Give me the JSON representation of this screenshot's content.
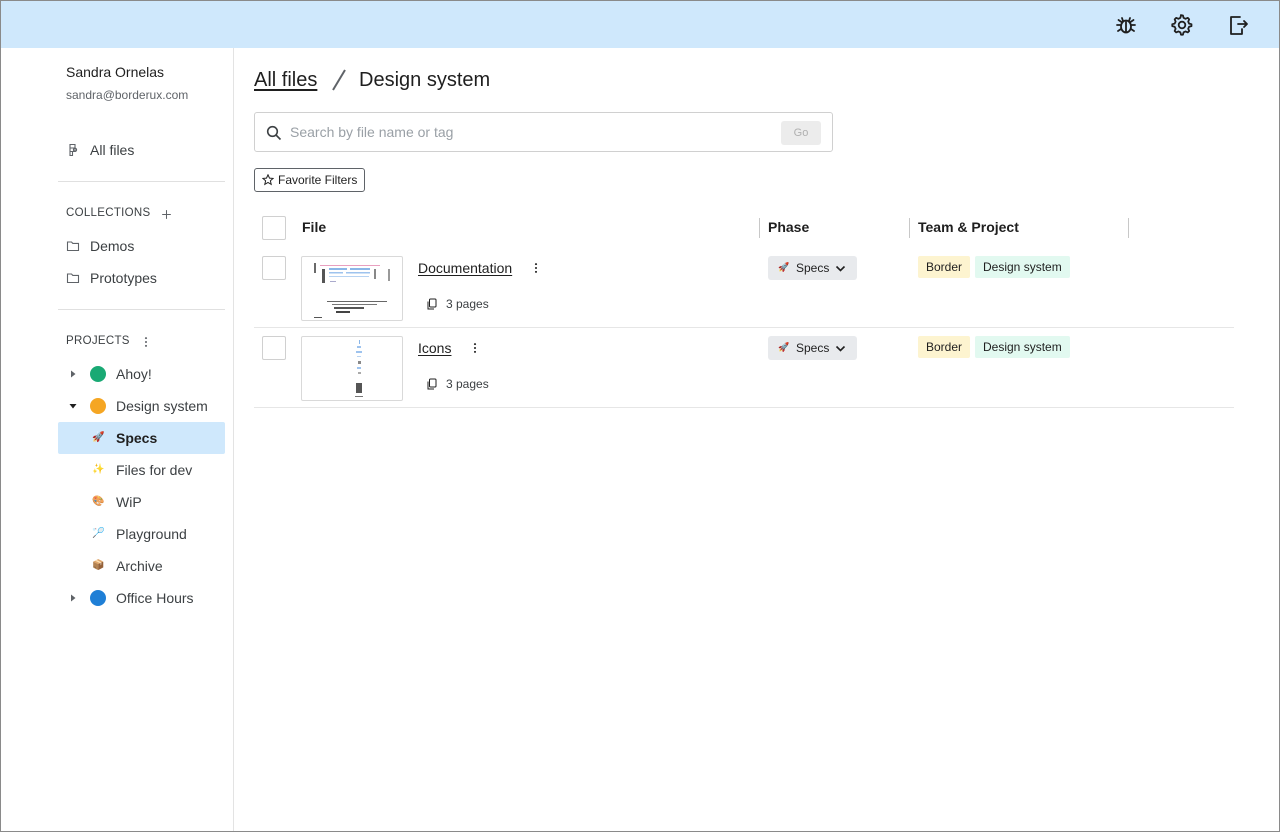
{
  "topbar": {
    "icons": [
      "bug-icon",
      "settings-gear-icon",
      "logout-icon"
    ]
  },
  "user": {
    "name": "Sandra Ornelas",
    "email": "sandra@borderux.com"
  },
  "sidebar": {
    "all_files": "All files",
    "collections_title": "COLLECTIONS",
    "collections": [
      {
        "label": "Demos",
        "icon": "folder-icon"
      },
      {
        "label": "Prototypes",
        "icon": "folder-icon"
      }
    ],
    "projects_title": "PROJECTS",
    "projects": [
      {
        "label": "Ahoy!",
        "color": "#19a974",
        "expanded": false
      },
      {
        "label": "Design system",
        "color": "#f5a623",
        "expanded": true
      },
      {
        "label": "Office Hours",
        "color": "#1f7fd6",
        "expanded": false
      }
    ],
    "design_system_children": [
      {
        "emoji": "🚀",
        "label": "Specs",
        "active": true
      },
      {
        "emoji": "✨",
        "label": "Files for dev",
        "active": false
      },
      {
        "emoji": "🎨",
        "label": "WiP",
        "active": false
      },
      {
        "emoji": "🏸",
        "label": "Playground",
        "active": false
      },
      {
        "emoji": "📦",
        "label": "Archive",
        "active": false
      }
    ]
  },
  "breadcrumb": {
    "root": "All files",
    "current": "Design system"
  },
  "search": {
    "placeholder": "Search by file name or tag",
    "value": "",
    "go_label": "Go"
  },
  "favorite_filters_label": "Favorite Filters",
  "table": {
    "headers": {
      "file": "File",
      "phase": "Phase",
      "team_project": "Team & Project"
    },
    "rows": [
      {
        "name": "Documentation",
        "pages": "3 pages",
        "phase_emoji": "🚀",
        "phase": "Specs",
        "team": "Border",
        "project": "Design system"
      },
      {
        "name": "Icons",
        "pages": "3 pages",
        "phase_emoji": "🚀",
        "phase": "Specs",
        "team": "Border",
        "project": "Design system"
      }
    ]
  },
  "colors": {
    "topbar": "#cfe8fc",
    "active_item": "#cfe8fc",
    "team_tag": "#fdf4d0",
    "project_tag": "#e2f9f0",
    "phase_chip": "#e8eaed"
  }
}
